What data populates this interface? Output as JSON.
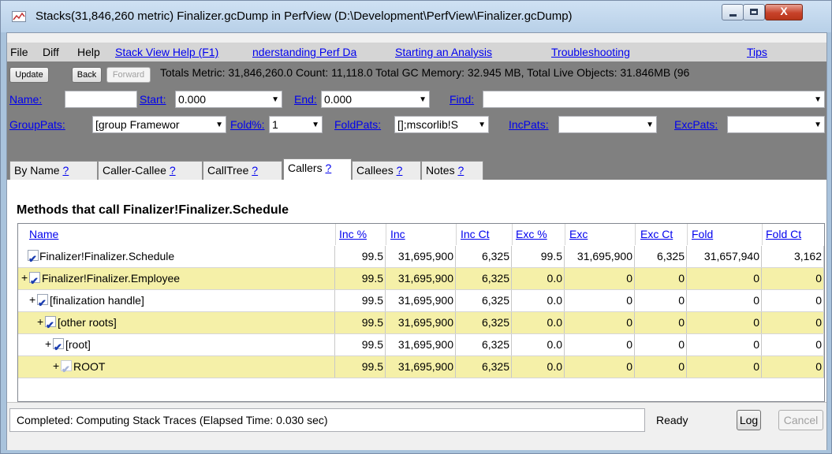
{
  "window": {
    "title": "Stacks(31,846,260 metric) Finalizer.gcDump in PerfView (D:\\Development\\PerfView\\Finalizer.gcDump)",
    "minimize_glyph": "",
    "maximize_glyph": "",
    "close_glyph": "X"
  },
  "menu": {
    "file": "File",
    "diff": "Diff",
    "help": "Help",
    "links": [
      "Stack View Help (F1)",
      "nderstanding Perf Da",
      "Starting an Analysis",
      "Troubleshooting",
      "Tips"
    ]
  },
  "toolbar": {
    "update": "Update",
    "back": "Back",
    "forward": "Forward",
    "totals": "Totals Metric: 31,846,260.0  Count: 11,118.0 Total GC Memory: 32.945 MB, Total Live Objects: 31.846MB (96"
  },
  "filters": {
    "name_label": "Name:",
    "name_value": "",
    "start_label": "Start:",
    "start_value": "0.000",
    "end_label": "End:",
    "end_value": "0.000",
    "find_label": "Find:",
    "find_value": ""
  },
  "grouping": {
    "grouppats_label": "GroupPats:",
    "grouppats_value": "[group Framewor",
    "foldpct_label": "Fold%:",
    "foldpct_value": "1",
    "foldpats_label": "FoldPats:",
    "foldpats_value": "[];mscorlib!S",
    "incpats_label": "IncPats:",
    "incpats_value": "",
    "excpats_label": "ExcPats:",
    "excpats_value": ""
  },
  "tabs": [
    {
      "label": "By Name",
      "help": "?"
    },
    {
      "label": "Caller-Callee",
      "help": "?"
    },
    {
      "label": "CallTree",
      "help": "?"
    },
    {
      "label": "Callers",
      "help": "?"
    },
    {
      "label": "Callees",
      "help": "?"
    },
    {
      "label": "Notes",
      "help": "?"
    }
  ],
  "panel": {
    "heading": "Methods that call Finalizer!Finalizer.Schedule"
  },
  "grid": {
    "columns": [
      "Name",
      "Inc %",
      "Inc",
      "Inc Ct",
      "Exc %",
      "Exc",
      "Exc Ct",
      "Fold",
      "Fold Ct"
    ],
    "rows": [
      {
        "name": "Finalizer!Finalizer.Schedule",
        "plus": "",
        "inc_pct": "99.5",
        "inc": "31,695,900",
        "inc_ct": "6,325",
        "exc_pct": "99.5",
        "exc": "31,695,900",
        "exc_ct": "6,325",
        "fold": "31,657,940",
        "fold_ct": "3,162"
      },
      {
        "name": "Finalizer!Finalizer.Employee",
        "plus": "+",
        "inc_pct": "99.5",
        "inc": "31,695,900",
        "inc_ct": "6,325",
        "exc_pct": "0.0",
        "exc": "0",
        "exc_ct": "0",
        "fold": "0",
        "fold_ct": "0"
      },
      {
        "name": "[finalization handle]",
        "plus": "+",
        "inc_pct": "99.5",
        "inc": "31,695,900",
        "inc_ct": "6,325",
        "exc_pct": "0.0",
        "exc": "0",
        "exc_ct": "0",
        "fold": "0",
        "fold_ct": "0"
      },
      {
        "name": "[other roots]",
        "plus": "+",
        "inc_pct": "99.5",
        "inc": "31,695,900",
        "inc_ct": "6,325",
        "exc_pct": "0.0",
        "exc": "0",
        "exc_ct": "0",
        "fold": "0",
        "fold_ct": "0"
      },
      {
        "name": "[root]",
        "plus": "+",
        "inc_pct": "99.5",
        "inc": "31,695,900",
        "inc_ct": "6,325",
        "exc_pct": "0.0",
        "exc": "0",
        "exc_ct": "0",
        "fold": "0",
        "fold_ct": "0"
      },
      {
        "name": "ROOT",
        "plus": "+",
        "inc_pct": "99.5",
        "inc": "31,695,900",
        "inc_ct": "6,325",
        "exc_pct": "0.0",
        "exc": "0",
        "exc_ct": "0",
        "fold": "0",
        "fold_ct": "0"
      }
    ]
  },
  "status": {
    "message": "Completed: Computing Stack Traces   (Elapsed Time: 0.030 sec)",
    "ready": "Ready",
    "log": "Log",
    "cancel": "Cancel"
  },
  "colors": {
    "title_bar": "#b8d0e8",
    "toolbar_gray": "#808080",
    "row_highlight": "#f5f0a8",
    "link": "#0000ee",
    "checkbox": "#1a3cb0"
  }
}
